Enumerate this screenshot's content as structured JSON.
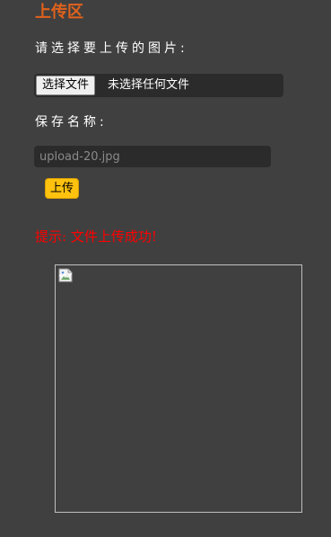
{
  "page": {
    "title": "上传区",
    "choose_label": "请选择要上传的图片:",
    "name_label": "保存名称:",
    "tip": "提示: 文件上传成功!"
  },
  "file_input": {
    "button_label": "选择文件",
    "status": "未选择任何文件"
  },
  "name_input": {
    "value": "",
    "placeholder": "upload-20.jpg"
  },
  "upload_button": {
    "label": "上传"
  },
  "preview": {
    "icon": "broken-image-icon"
  },
  "colors": {
    "background": "#404040",
    "title": "#e0621c",
    "tip": "#ff0000",
    "upload_button": "#ffc20e",
    "field_bg": "#2b2b2b"
  }
}
